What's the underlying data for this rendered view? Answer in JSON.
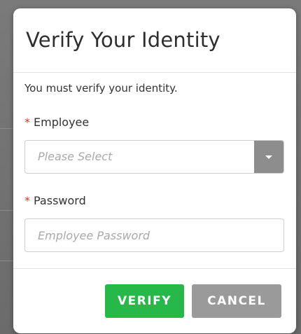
{
  "dialog": {
    "title": "Verify Your Identity",
    "intro": "You must verify your identity."
  },
  "employee": {
    "required_mark": "*",
    "label": "Employee",
    "placeholder": "Please Select",
    "caret_icon": "chevron-down-icon"
  },
  "password": {
    "required_mark": "*",
    "label": "Password",
    "placeholder": "Employee Password",
    "value": ""
  },
  "actions": {
    "verify_label": "VERIFY",
    "cancel_label": "CANCEL"
  },
  "colors": {
    "verify": "#27b84a",
    "cancel": "#9a9a9a",
    "required": "#e0342e",
    "select_button": "#8d8d8d"
  }
}
